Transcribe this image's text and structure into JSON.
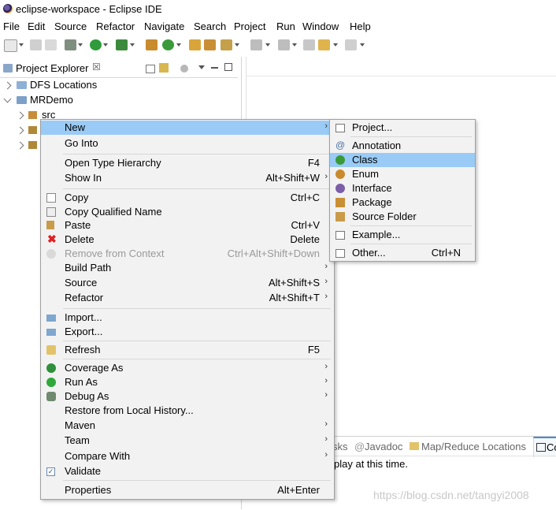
{
  "window": {
    "title": "eclipse-workspace - Eclipse IDE"
  },
  "menubar": [
    "File",
    "Edit",
    "Source",
    "Refactor",
    "Navigate",
    "Search",
    "Project",
    "Run",
    "Window",
    "Help"
  ],
  "explorer": {
    "title": "Project Explorer",
    "close_glyph": "☒",
    "tree": [
      {
        "label": "DFS Locations"
      },
      {
        "label": "MRDemo"
      },
      {
        "label": "src"
      }
    ]
  },
  "context_menu": {
    "items": [
      {
        "label": "New",
        "shortcut": "",
        "submenu": "›"
      },
      {
        "label": "Go Into",
        "shortcut": ""
      },
      {
        "label": "Open Type Hierarchy",
        "shortcut": "F4"
      },
      {
        "label": "Show In",
        "shortcut": "Alt+Shift+W",
        "submenu": "›"
      },
      {
        "label": "Copy",
        "shortcut": "Ctrl+C"
      },
      {
        "label": "Copy Qualified Name",
        "shortcut": ""
      },
      {
        "label": "Paste",
        "shortcut": "Ctrl+V"
      },
      {
        "label": "Delete",
        "shortcut": "Delete"
      },
      {
        "label": "Remove from Context",
        "shortcut": "Ctrl+Alt+Shift+Down"
      },
      {
        "label": "Build Path",
        "shortcut": "",
        "submenu": "›"
      },
      {
        "label": "Source",
        "shortcut": "Alt+Shift+S",
        "submenu": "›"
      },
      {
        "label": "Refactor",
        "shortcut": "Alt+Shift+T",
        "submenu": "›"
      },
      {
        "label": "Import...",
        "shortcut": ""
      },
      {
        "label": "Export...",
        "shortcut": ""
      },
      {
        "label": "Refresh",
        "shortcut": "F5"
      },
      {
        "label": "Coverage As",
        "shortcut": "",
        "submenu": "›"
      },
      {
        "label": "Run As",
        "shortcut": "",
        "submenu": "›"
      },
      {
        "label": "Debug As",
        "shortcut": "",
        "submenu": "›"
      },
      {
        "label": "Restore from Local History...",
        "shortcut": ""
      },
      {
        "label": "Maven",
        "shortcut": "",
        "submenu": "›"
      },
      {
        "label": "Team",
        "shortcut": "",
        "submenu": "›"
      },
      {
        "label": "Compare With",
        "shortcut": "",
        "submenu": "›"
      },
      {
        "label": "Validate",
        "shortcut": ""
      },
      {
        "label": "Properties",
        "shortcut": "Alt+Enter"
      }
    ]
  },
  "new_submenu": {
    "items": [
      {
        "label": "Project...",
        "shortcut": ""
      },
      {
        "label": "Annotation",
        "shortcut": ""
      },
      {
        "label": "Class",
        "shortcut": ""
      },
      {
        "label": "Enum",
        "shortcut": ""
      },
      {
        "label": "Interface",
        "shortcut": ""
      },
      {
        "label": "Package",
        "shortcut": ""
      },
      {
        "label": "Source Folder",
        "shortcut": ""
      },
      {
        "label": "Example...",
        "shortcut": ""
      },
      {
        "label": "Other...",
        "shortcut": "Ctrl+N"
      }
    ]
  },
  "bottom_panel": {
    "tabs": [
      "sks",
      "Javadoc",
      "Map/Reduce Locations",
      "Co"
    ],
    "message": "play at this time."
  },
  "watermark": "https://blog.csdn.net/tangyi2008",
  "colors": {
    "highlight": "#99cbf6",
    "menu_bg": "#f2f2f2"
  }
}
